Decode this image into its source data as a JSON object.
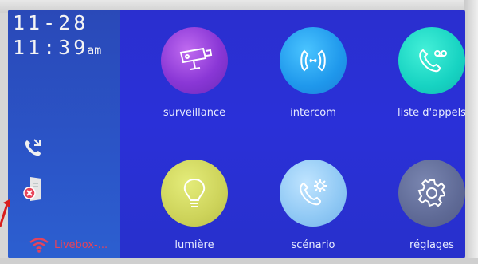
{
  "status": {
    "date": "11-28",
    "time": "11:39",
    "ampm": "am"
  },
  "sidebar": {
    "icons": [
      "missed-call-icon",
      "door-phone-error-icon"
    ],
    "wifi": {
      "icon": "wifi-icon",
      "label": "Livebox-...",
      "color": "#e6435a"
    }
  },
  "menu": [
    {
      "label": "surveillance",
      "icon": "camera-icon",
      "color": "#8a37d6"
    },
    {
      "label": "intercom",
      "icon": "intercom-icon",
      "color": "#1f98ec"
    },
    {
      "label": "liste d'appels",
      "icon": "call-log-icon",
      "color": "#17d3c2"
    },
    {
      "label": "lumière",
      "icon": "light-bulb-icon",
      "color": "#cdd35a"
    },
    {
      "label": "scénario",
      "icon": "phone-settings-icon",
      "color": "#8fc8f4"
    },
    {
      "label": "réglages",
      "icon": "gear-icon",
      "color": "#5f6a96"
    }
  ]
}
